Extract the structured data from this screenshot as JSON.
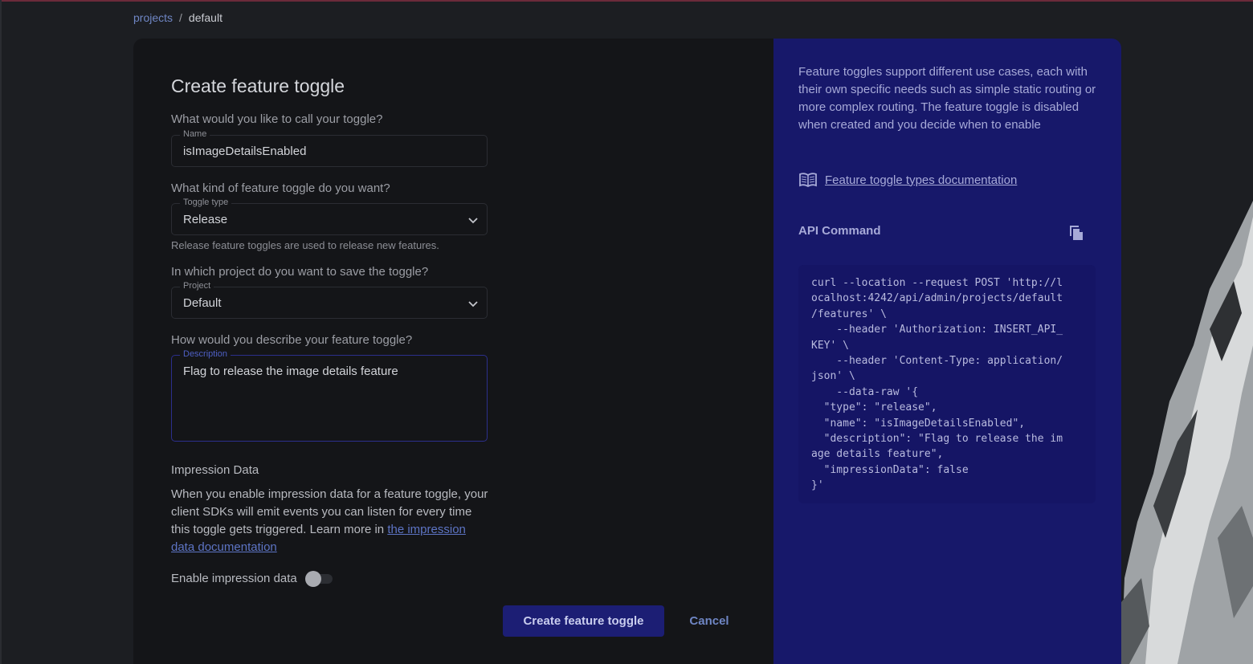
{
  "breadcrumb": {
    "link": "projects",
    "separator": "/",
    "current": "default"
  },
  "form": {
    "title": "Create feature toggle",
    "name_question": "What would you like to call your toggle?",
    "name_label": "Name",
    "name_value": "isImageDetailsEnabled",
    "type_question": "What kind of feature toggle do you want?",
    "type_label": "Toggle type",
    "type_value": "Release",
    "type_helper": "Release feature toggles are used to release new features.",
    "project_question": "In which project do you want to save the toggle?",
    "project_label": "Project",
    "project_value": "Default",
    "description_question": "How would you describe your feature toggle?",
    "description_label": "Description",
    "description_value": "Flag to release the image details feature",
    "impression_title": "Impression Data",
    "impression_text": "When you enable impression data for a feature toggle, your client SDKs will emit events you can listen for every time this toggle gets triggered. Learn more in ",
    "impression_link": "the impression data documentation",
    "impression_toggle_label": "Enable impression data",
    "impression_enabled": false,
    "create_button": "Create feature toggle",
    "cancel_button": "Cancel"
  },
  "sidebar": {
    "description": "Feature toggles support different use cases, each with their own specific needs such as simple static routing or more complex routing. The feature toggle is disabled when created and you decide when to enable",
    "doc_link": "Feature toggle types documentation",
    "doc_icon": "book-icon",
    "api_title": "API Command",
    "copy_icon": "copy-icon",
    "api_command": "curl --location --request POST 'http://l\nocalhost:4242/api/admin/projects/default\n/features' \\\n    --header 'Authorization: INSERT_API_\nKEY' \\\n    --header 'Content-Type: application/\njson' \\\n    --data-raw '{\n  \"type\": \"release\",\n  \"name\": \"isImageDetailsEnabled\",\n  \"description\": \"Flag to release the im\nage details feature\",\n  \"impressionData\": false\n}'"
  },
  "colors": {
    "page_bg": "#1c1e22",
    "form_bg": "#141518",
    "sidebar_bg": "#17186a",
    "primary_button": "#1c1e74",
    "link": "#6f86c4"
  }
}
